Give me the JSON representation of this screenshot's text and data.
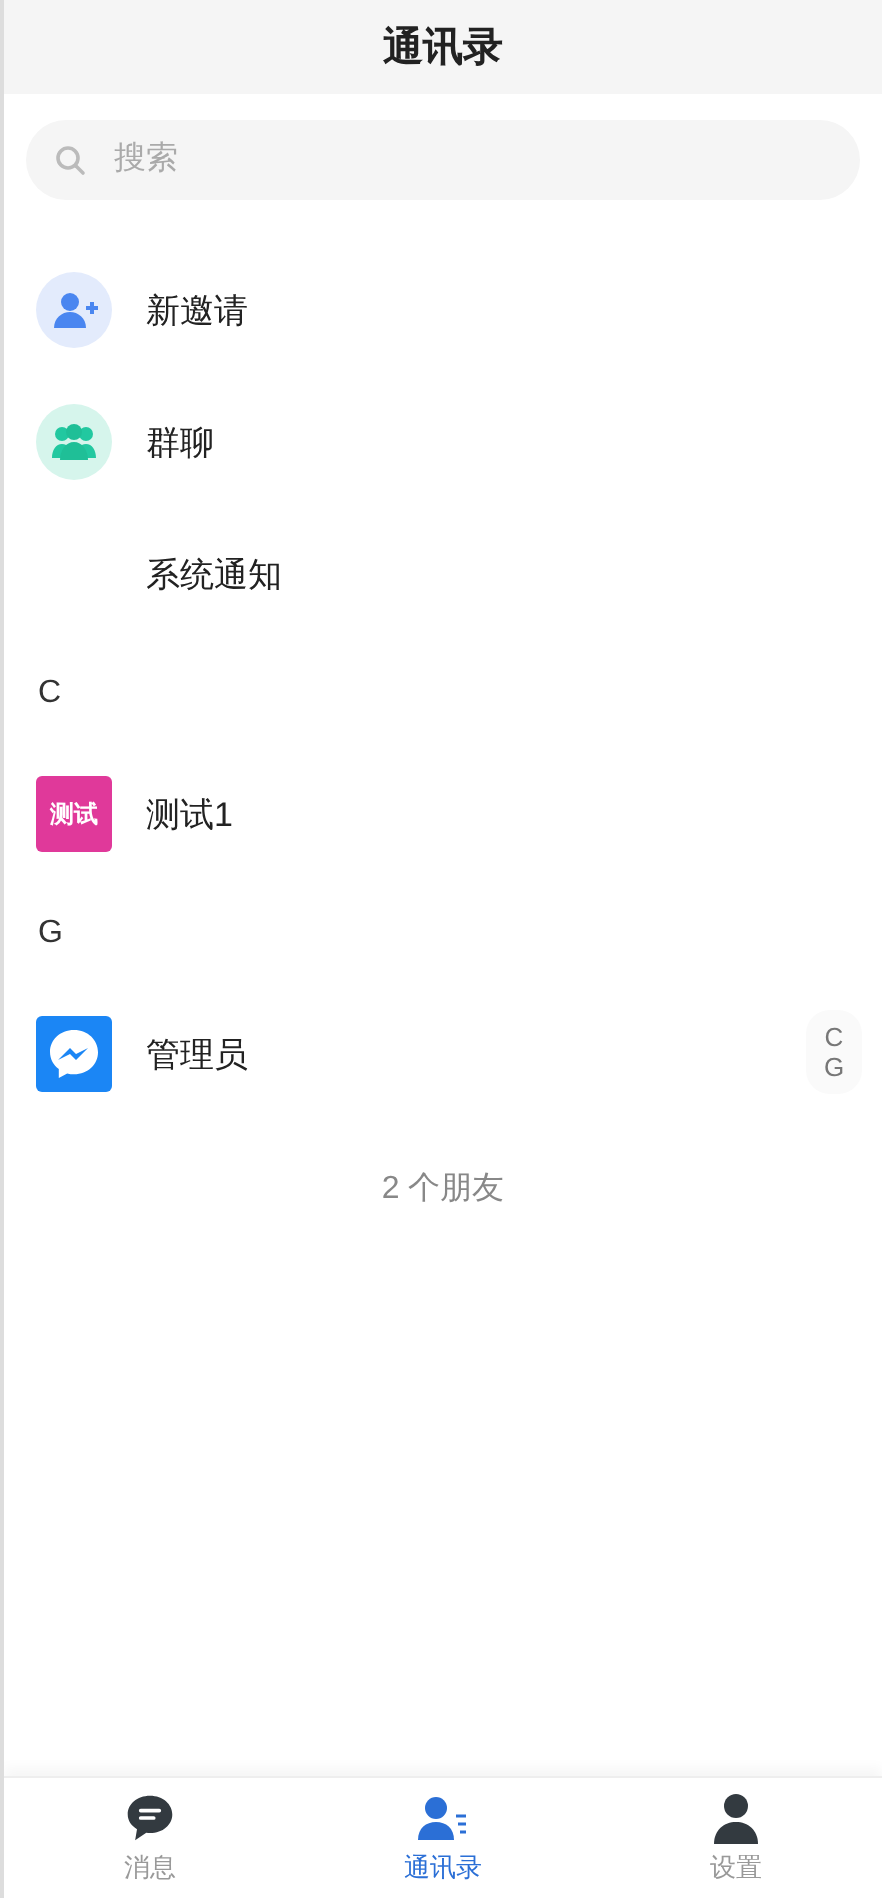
{
  "header": {
    "title": "通讯录"
  },
  "search": {
    "placeholder": "搜索"
  },
  "entries": [
    {
      "kind": "invite",
      "label": "新邀请"
    },
    {
      "kind": "group",
      "label": "群聊"
    },
    {
      "kind": "plain",
      "label": "系统通知"
    }
  ],
  "sections": [
    {
      "letter": "C",
      "contacts": [
        {
          "kind": "text-avatar",
          "avatar_text": "测试",
          "color": "#e0399a",
          "name": "测试1"
        }
      ]
    },
    {
      "letter": "G",
      "contacts": [
        {
          "kind": "messenger",
          "name": "管理员"
        }
      ]
    }
  ],
  "index_bar": [
    "C",
    "G"
  ],
  "friend_count": "2 个朋友",
  "tabs": [
    {
      "kind": "chat",
      "label": "消息",
      "selected": false
    },
    {
      "kind": "contacts",
      "label": "通讯录",
      "selected": true
    },
    {
      "kind": "person",
      "label": "设置",
      "selected": false
    }
  ]
}
